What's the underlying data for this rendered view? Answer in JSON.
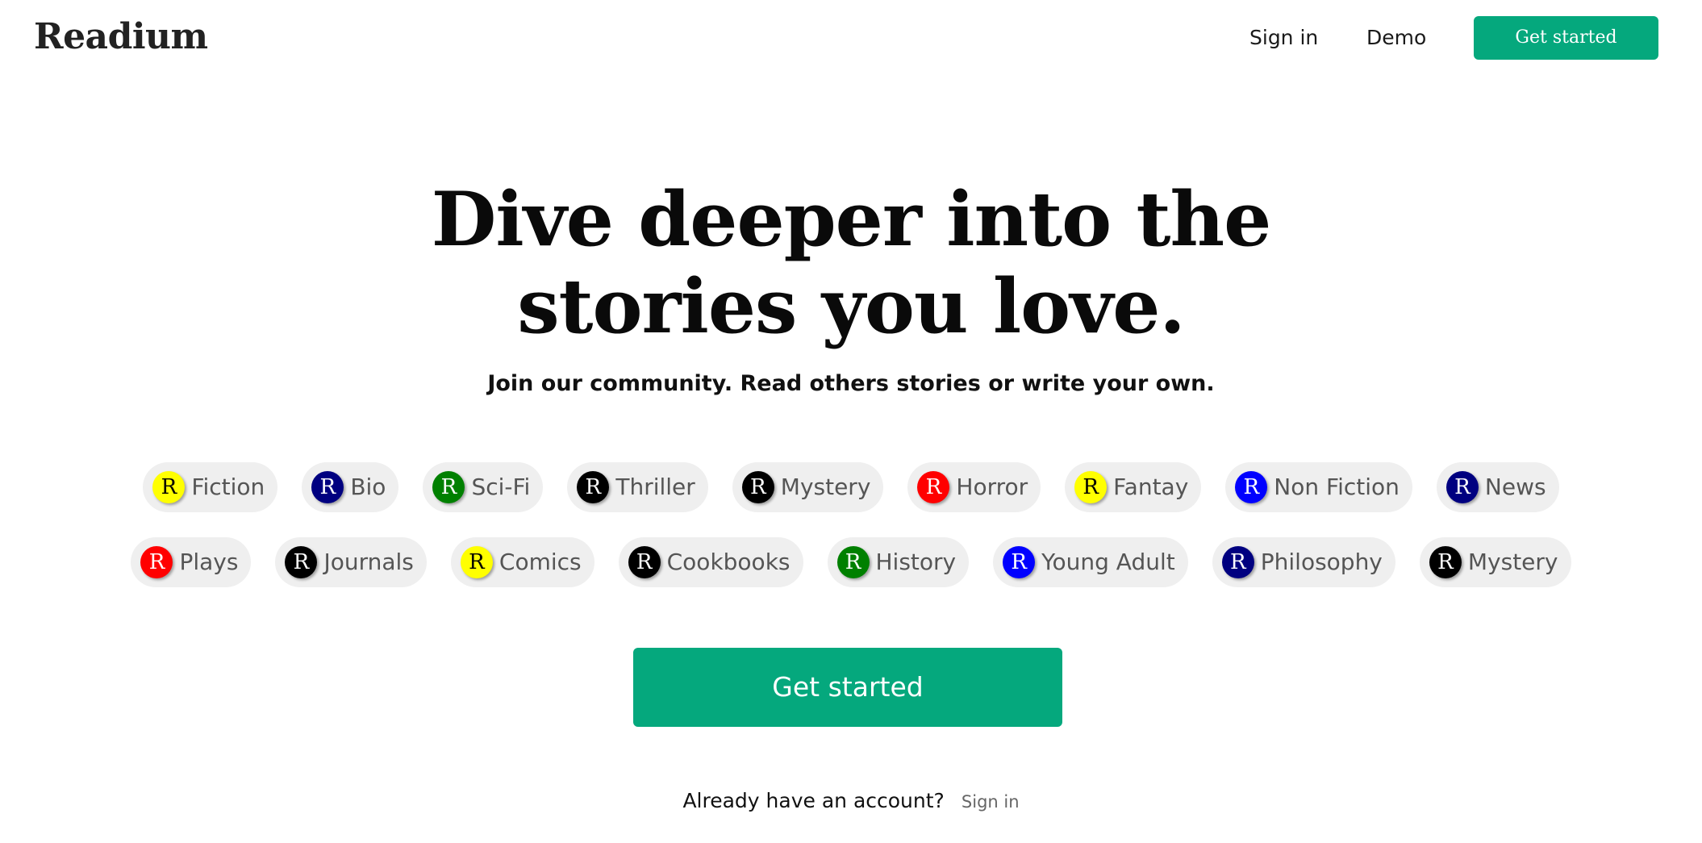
{
  "brand": {
    "name": "Readium"
  },
  "nav": {
    "sign_in": "Sign in",
    "demo": "Demo",
    "get_started": "Get started",
    "cta_color": "#05a87d"
  },
  "hero": {
    "title_line1": "Dive deeper into the",
    "title_line2": "stories you love.",
    "subtitle": "Join our community. Read others stories or write your own."
  },
  "genres": {
    "row1": [
      {
        "badge": "R",
        "label": "Fiction",
        "color": "#ffff00",
        "text_color": "#000000"
      },
      {
        "badge": "R",
        "label": "Bio",
        "color": "#000080",
        "text_color": "#ffffff"
      },
      {
        "badge": "R",
        "label": "Sci-Fi",
        "color": "#008000",
        "text_color": "#ffffff"
      },
      {
        "badge": "R",
        "label": "Thriller",
        "color": "#000000",
        "text_color": "#ffffff"
      },
      {
        "badge": "R",
        "label": "Mystery",
        "color": "#000000",
        "text_color": "#ffffff"
      },
      {
        "badge": "R",
        "label": "Horror",
        "color": "#ff0000",
        "text_color": "#ffffff"
      },
      {
        "badge": "R",
        "label": "Fantay",
        "color": "#ffff00",
        "text_color": "#000000"
      },
      {
        "badge": "R",
        "label": "Non Fiction",
        "color": "#0000ff",
        "text_color": "#ffffff"
      },
      {
        "badge": "R",
        "label": "News",
        "color": "#000080",
        "text_color": "#ffffff"
      }
    ],
    "row2": [
      {
        "badge": "R",
        "label": "Plays",
        "color": "#ff0000",
        "text_color": "#ffffff"
      },
      {
        "badge": "R",
        "label": "Journals",
        "color": "#000000",
        "text_color": "#ffffff"
      },
      {
        "badge": "R",
        "label": "Comics",
        "color": "#ffff00",
        "text_color": "#000000"
      },
      {
        "badge": "R",
        "label": "Cookbooks",
        "color": "#000000",
        "text_color": "#ffffff"
      },
      {
        "badge": "R",
        "label": "History",
        "color": "#008000",
        "text_color": "#ffffff"
      },
      {
        "badge": "R",
        "label": "Young Adult",
        "color": "#0000ff",
        "text_color": "#ffffff"
      },
      {
        "badge": "R",
        "label": "Philosophy",
        "color": "#000080",
        "text_color": "#ffffff"
      },
      {
        "badge": "R",
        "label": "Mystery",
        "color": "#000000",
        "text_color": "#ffffff"
      }
    ]
  },
  "cta": {
    "label": "Get started"
  },
  "footer": {
    "prompt": "Already have an account?",
    "sign_in": "Sign in"
  }
}
